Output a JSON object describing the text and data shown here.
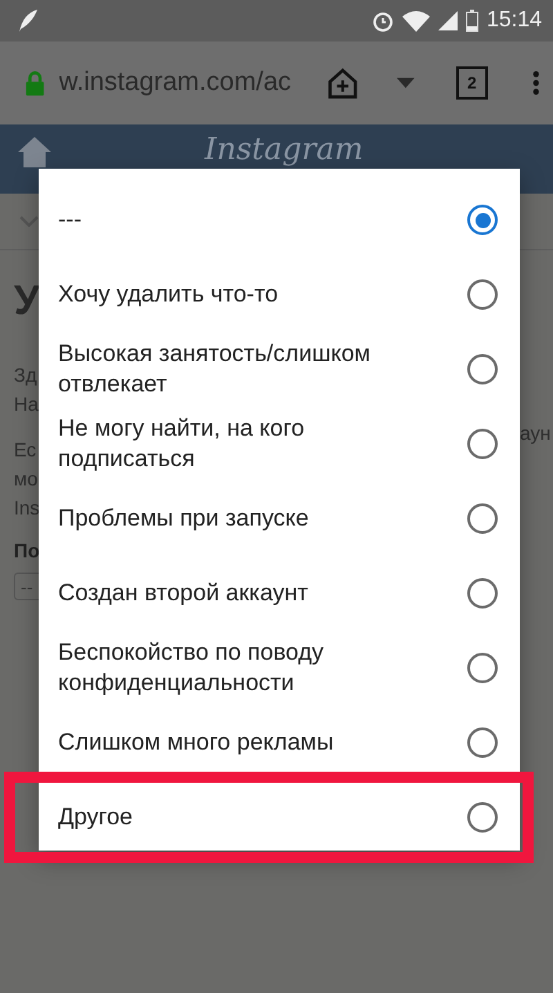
{
  "status_bar": {
    "time": "15:14"
  },
  "browser": {
    "url": "w.instagram.com/ac",
    "tab_count": "2"
  },
  "header": {
    "logo": "Instagram"
  },
  "background_page": {
    "heading": "У",
    "fragments": [
      "Зд",
      "На",
      "Ес",
      "мо",
      "Ins"
    ],
    "right_fragment": "аун",
    "label": "По",
    "select_value": "--"
  },
  "dialog": {
    "options": [
      {
        "label": "---",
        "selected": true,
        "highlighted": false
      },
      {
        "label": "Хочу удалить что-то",
        "selected": false,
        "highlighted": false
      },
      {
        "label": "Высокая занятость/слишком отвлекает",
        "selected": false,
        "highlighted": false
      },
      {
        "label": "Не могу найти, на кого подписаться",
        "selected": false,
        "highlighted": false
      },
      {
        "label": "Проблемы при запуске",
        "selected": false,
        "highlighted": false
      },
      {
        "label": "Создан второй аккаунт",
        "selected": false,
        "highlighted": false
      },
      {
        "label": "Беспокойство по поводу конфиденциальности",
        "selected": false,
        "highlighted": false
      },
      {
        "label": "Слишком много рекламы",
        "selected": false,
        "highlighted": false
      },
      {
        "label": "Другое",
        "selected": false,
        "highlighted": true
      }
    ]
  }
}
